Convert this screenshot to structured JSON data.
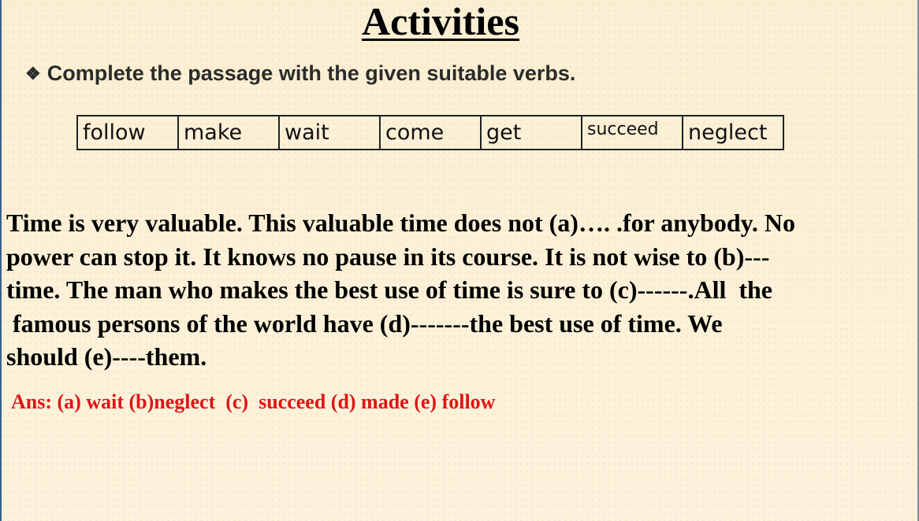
{
  "title": "Activities",
  "instruction": {
    "bullet_icon": "❖",
    "text": "Complete the passage with the given suitable verbs."
  },
  "word_bank": [
    "follow",
    "make",
    "wait",
    "come",
    "get",
    "succeed",
    "neglect"
  ],
  "passage_lines": [
    "Time is very valuable. This valuable time does not (a)…. .for anybody. No",
    "power can stop it. It knows no pause in its course. It is not wise to (b)---",
    "time. The man who makes the best use of time is sure to (c)------.All  the",
    " famous persons of the world have (d)-------the best use of time. We",
    "should (e)----them."
  ],
  "answer": "Ans: (a) wait (b)neglect  (c)  succeed (d) made (e) follow",
  "colors": {
    "answer": "#e01414",
    "left_frame": "#3c5f8e",
    "background": "#fcf1d8"
  }
}
